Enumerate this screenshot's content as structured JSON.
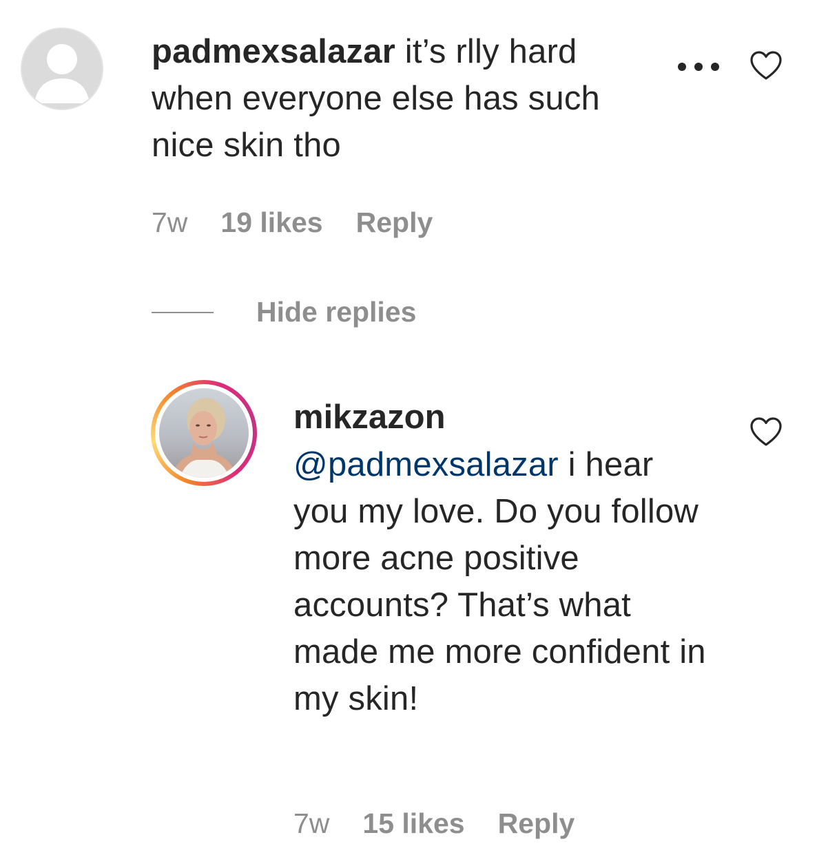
{
  "comments": [
    {
      "username": "padmexsalazar",
      "text": " it’s rlly hard when everyone else has such nice skin tho",
      "time": "7w",
      "likes": "19 likes",
      "reply_label": "Reply",
      "more_icon": "more-horizontal-icon",
      "like_icon": "heart-outline-icon"
    }
  ],
  "replies_toggle": {
    "label": "Hide replies"
  },
  "replies": [
    {
      "username": "mikzazon",
      "mention": "@padmexsalazar",
      "text": " i hear you my love. Do you follow more acne positive accounts? That’s what made me more confident in my skin!",
      "time": "7w",
      "likes": "15 likes",
      "reply_label": "Reply",
      "like_icon": "heart-outline-icon",
      "has_story_ring": true
    }
  ],
  "colors": {
    "text": "#262626",
    "secondary_text": "#8e8e8e",
    "mention": "#00376b",
    "story_ring_start": "#f58529",
    "story_ring_end": "#dd2a7b"
  }
}
